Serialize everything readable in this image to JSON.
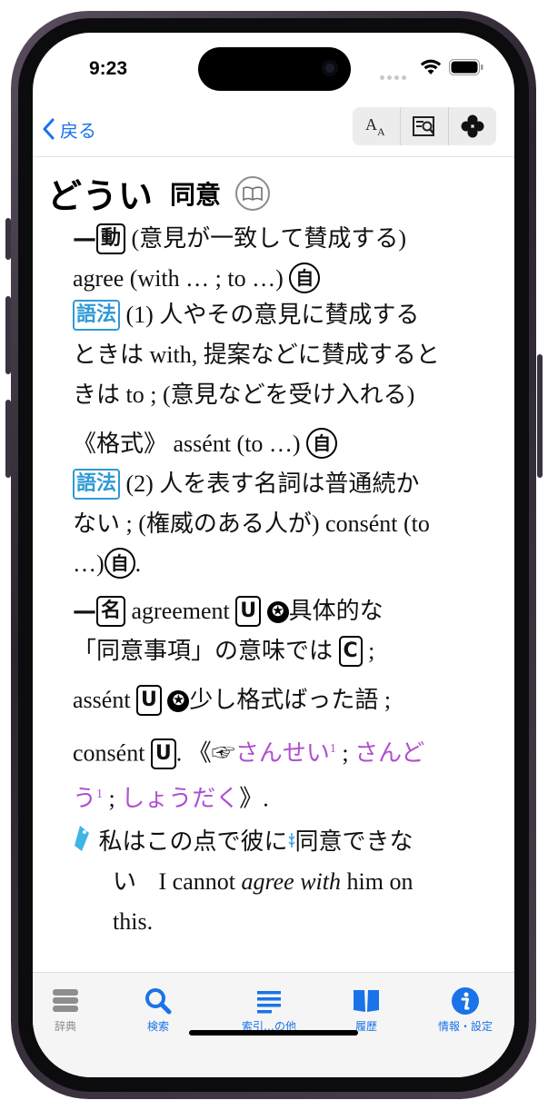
{
  "status": {
    "time": "9:23"
  },
  "nav": {
    "back_label": "戻る"
  },
  "entry": {
    "headword_kana": "どうい",
    "headword_kanji": "同意",
    "verb_section": {
      "pos_label": "動",
      "gloss": "(意見が一致して賛成する)",
      "line1": "agree (with … ; to …)",
      "intransitive_label": "自",
      "usage_label": "語法",
      "note1_a": "(1) 人やその意見に賛成する",
      "note1_b": "ときは with, 提案などに賛成すると",
      "note1_c": "きは to ; (意見などを受け入れる)",
      "formal": "《格式》 assént (to …)",
      "note2_a": "(2) 人を表す名詞は普通続か",
      "note2_b": "ない ; (権威のある人が) consént (to",
      "note2_c": "…)",
      "period": "."
    },
    "noun_section": {
      "pos_label": "名",
      "word": "agreement",
      "uncount_label": "U",
      "count_label": "C",
      "star": "✪",
      "text_a": "具体的な",
      "text_b": "「同意事項」の意味では",
      "semi": ";",
      "word2": "assént",
      "text_c": "少し格式ばった語 ;",
      "word3": "consént",
      "ref_open": ". 《☞",
      "link1": "さんせい",
      "link1_sup": "1",
      "ref_sep": " ; ",
      "link2": "さんど",
      "link2_cont": "う",
      "link2_sup": "1",
      "ref_sep2": " ; ",
      "link3": "しょうだく",
      "ref_close": "》."
    },
    "example": {
      "jp_a": "私はこの点で彼に",
      "jp_b": "同意できな",
      "jp_c": "い",
      "en_a": "I cannot",
      "en_italic": "agree with",
      "en_b": "him on",
      "en_c": "this."
    }
  },
  "tabs": [
    {
      "label": "辞典"
    },
    {
      "label": "検索"
    },
    {
      "label": "索引…の他"
    },
    {
      "label": "履歴"
    },
    {
      "label": "情報・設定"
    }
  ],
  "colors": {
    "accent": "#1a73e8",
    "usage": "#2e9ad6",
    "link": "#b04fd0",
    "tab_active": "#1a73e8",
    "tab_inactive": "#8e8e8e"
  }
}
